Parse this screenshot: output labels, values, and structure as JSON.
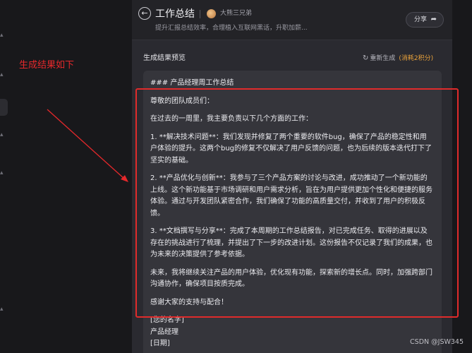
{
  "header": {
    "back_icon": "arrow-left-icon",
    "title": "工作总结",
    "author_name": "大熊三兄弟",
    "subtitle": "提升汇报总结效率，合理植入互联网黑话，升职加薪...",
    "share_label": "分享",
    "share_icon": "share-arrow-icon"
  },
  "preview": {
    "section_title": "生成结果预览",
    "regenerate_icon": "refresh-icon",
    "regenerate_label": "重新生成",
    "cost_note": "(消耗2积分)"
  },
  "document": {
    "heading": "### 产品经理周工作总结",
    "paragraphs": [
      "尊敬的团队成员们：",
      "在过去的一周里，我主要负责以下几个方面的工作：",
      "1. **解决技术问题**：我们发现并修复了两个重要的软件bug，确保了产品的稳定性和用户体验的提升。这两个bug的修复不仅解决了用户反馈的问题，也为后续的版本迭代打下了坚实的基础。",
      "2. **产品优化与创新**：我参与了三个产品方案的讨论与改进，成功推动了一个新功能的上线。这个新功能基于市场调研和用户需求分析，旨在为用户提供更加个性化和便捷的服务体验。通过与开发团队紧密合作，我们确保了功能的高质量交付，并收到了用户的积极反馈。",
      "3. **文档撰写与分享**：完成了本周期的工作总结报告，对已完成任务、取得的进展以及存在的挑战进行了梳理，并提出了下一步的改进计划。这份报告不仅记录了我们的成果，也为未来的决策提供了参考依据。",
      "未来，我将继续关注产品的用户体验，优化现有功能，探索新的增长点。同时，加强跨部门沟通协作，确保项目按质完成。",
      "感谢大家的支持与配合！"
    ],
    "signature": [
      "[您的名字]",
      "产品经理",
      "[日期]"
    ]
  },
  "annotation": {
    "text": "生成结果如下",
    "color": "#e5282b"
  },
  "watermark": "CSDN @JSW345",
  "colors": {
    "background": "#18181b",
    "panel": "#2a2a30",
    "card": "#35353b",
    "accent_cost": "#e9a23b",
    "highlight_box": "#e02b2b"
  }
}
